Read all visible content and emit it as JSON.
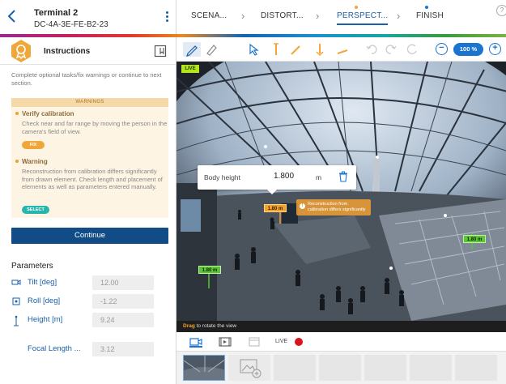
{
  "device": {
    "name": "Terminal 2",
    "mac": "DC-4A-3E-FE-B2-23"
  },
  "steps": [
    {
      "label": "SCENA..."
    },
    {
      "label": "DISTORT..."
    },
    {
      "label": "PERSPECT..."
    },
    {
      "label": "FINISH"
    }
  ],
  "instructions": {
    "title": "Instructions",
    "text": "Complete optional tasks/fix warnings or continue to next section.",
    "warnings_banner": "WARNINGS",
    "items": [
      {
        "title": "Verify calibration",
        "body": "Check near and far range by moving the person in the camera's field of view.",
        "action": "FIX"
      },
      {
        "title": "Warning",
        "body": "Reconstruction from calibration differs significantly from drawn element. Check length and placement of elements as well as parameters entered manually.",
        "action": "SELECT"
      }
    ],
    "continue_label": "Continue"
  },
  "parameters": {
    "title": "Parameters",
    "rows": [
      {
        "label": "Tilt [deg]",
        "value": "12.00",
        "icon": "tilt-icon"
      },
      {
        "label": "Roll [deg]",
        "value": "-1.22",
        "icon": "roll-icon"
      },
      {
        "label": "Height [m]",
        "value": "9.24",
        "icon": "height-icon"
      },
      {
        "label": "Focal Length ...",
        "value": "3.12",
        "icon": ""
      }
    ]
  },
  "toolbar": {
    "zoom": "100 %"
  },
  "view": {
    "live_tag": "LIVE",
    "popup": {
      "label": "Body height",
      "value": "1.800",
      "unit": "m"
    },
    "measurements": {
      "selected": "1.80 m",
      "left": "1.80 m",
      "right": "1.80 m"
    },
    "warning_text": "Reconstruction from calibration differs significantly",
    "hint_action": "Drag",
    "hint_text": "to rotate the view"
  },
  "bottom": {
    "live_label": "LIVE"
  },
  "colors": {
    "accent": "#1a5fa8",
    "continue": "#124c86",
    "warning": "#f0a73a",
    "select": "#27b5ae",
    "record": "#d8141e",
    "measure": "#5ec33a"
  }
}
